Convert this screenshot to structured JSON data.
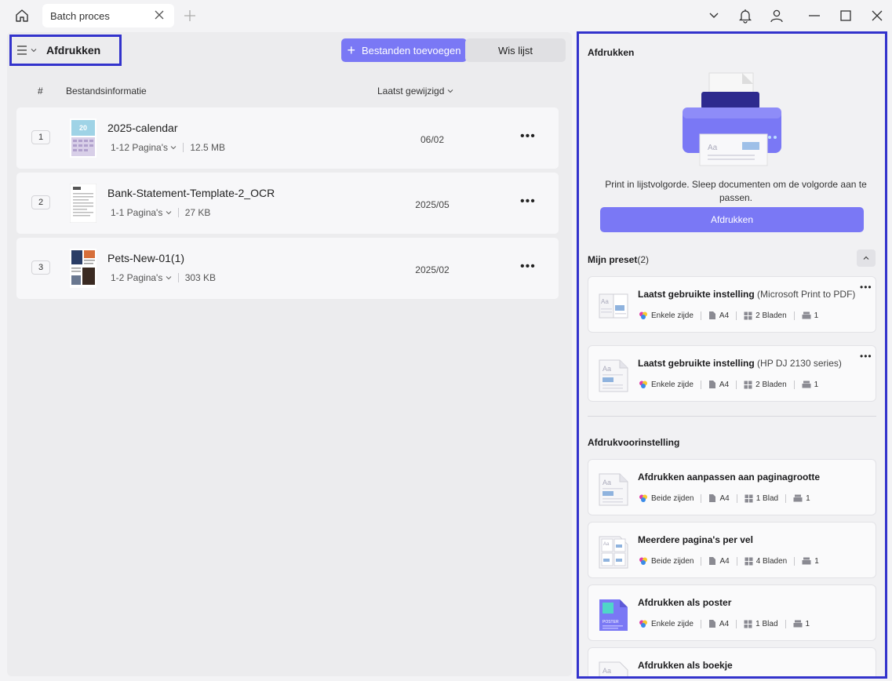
{
  "titlebar": {
    "tab_label": "Batch proces"
  },
  "toolbar": {
    "mode_title": "Afdrukken",
    "add_files_label": "Bestanden toevoegen",
    "clear_list_label": "Wis lijst"
  },
  "table": {
    "col_index": "#",
    "col_info": "Bestandsinformatie",
    "col_modified": "Laatst gewijzigd",
    "rows": [
      {
        "index": "1",
        "name": "2025-calendar",
        "pages": "1-12 Pagina's",
        "size": "12.5 MB",
        "date": "06/02"
      },
      {
        "index": "2",
        "name": "Bank-Statement-Template-2_OCR",
        "pages": "1-1 Pagina's",
        "size": "27 KB",
        "date": "2025/05"
      },
      {
        "index": "3",
        "name": "Pets-New-01(1)",
        "pages": "1-2 Pagina's",
        "size": "303 KB",
        "date": "2025/02"
      }
    ]
  },
  "print_panel": {
    "title": "Afdrukken",
    "description": "Print in lijstvolgorde. Sleep documenten om de volgorde aan te passen.",
    "print_button": "Afdrukken",
    "my_preset_title": "Mijn preset",
    "my_preset_count": "(2)",
    "my_presets": [
      {
        "name": "Laatst gebruikte instelling",
        "sub": "(Microsoft Print to PDF)",
        "sides": "Enkele zijde",
        "paper": "A4",
        "sheets": "2 Bladen",
        "copies": "1"
      },
      {
        "name": "Laatst gebruikte instelling",
        "sub": "(HP DJ 2130 series)",
        "sides": "Enkele zijde",
        "paper": "A4",
        "sheets": "2 Bladen",
        "copies": "1"
      }
    ],
    "preset_section_title": "Afdrukvoorinstelling",
    "presets": [
      {
        "name": "Afdrukken aanpassen aan paginagrootte",
        "sides": "Beide zijden",
        "paper": "A4",
        "sheets": "1 Blad",
        "copies": "1"
      },
      {
        "name": "Meerdere pagina's per vel",
        "sides": "Beide zijden",
        "paper": "A4",
        "sheets": "4 Bladen",
        "copies": "1"
      },
      {
        "name": "Afdrukken als poster",
        "sides": "Enkele zijde",
        "paper": "A4",
        "sheets": "1 Blad",
        "copies": "1"
      },
      {
        "name": "Afdrukken als boekje"
      }
    ]
  },
  "colors": {
    "accent": "#7a78f5",
    "highlight_border": "#3333cc"
  }
}
